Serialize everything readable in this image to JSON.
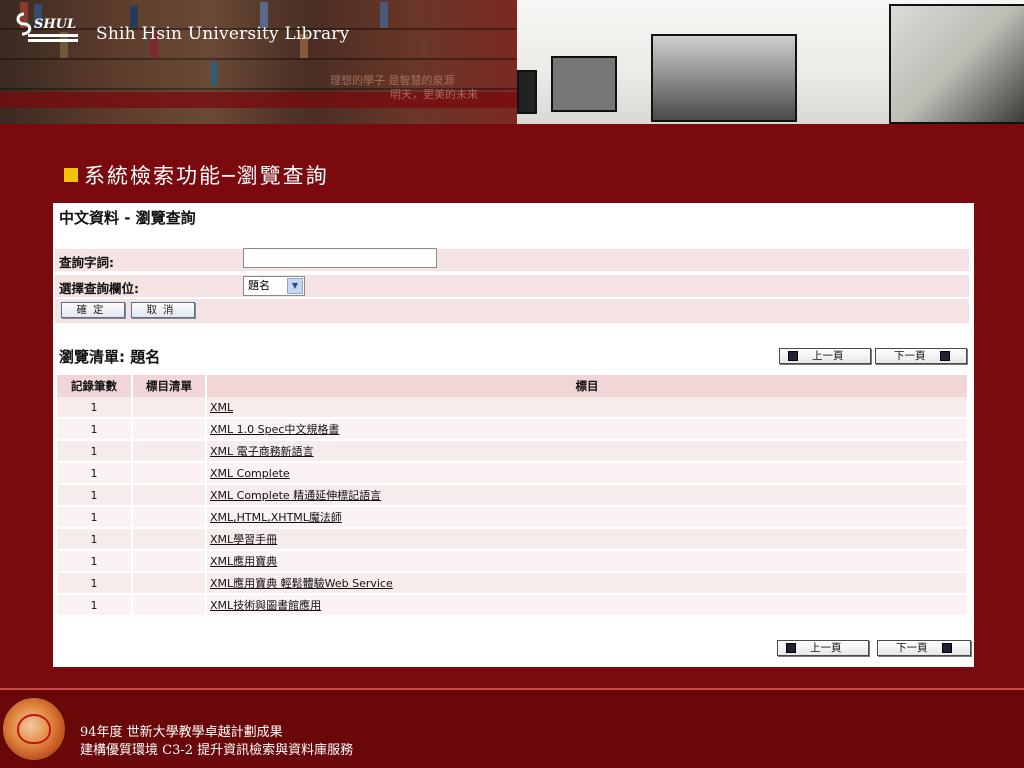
{
  "banner": {
    "library_name": "Shih Hsin University Library",
    "logo_text": "SHUL",
    "motto_line1": "理想的學子 是智慧的泉源",
    "motto_line2": "明天，更美的未來"
  },
  "slide": {
    "title": "系統檢索功能─瀏覽查詢",
    "bullet_color": "#f5c400"
  },
  "panel": {
    "title": "中文資料 - 瀏覽查詢",
    "query_label": "查詢字詞:",
    "query_value": "",
    "field_label": "選擇查詢欄位:",
    "field_selected": "題名",
    "confirm_label": "確定",
    "cancel_label": "取消",
    "list_title": "瀏覽清單: 題名",
    "prev_label": "上一頁",
    "next_label": "下一頁",
    "columns": {
      "count": "記錄筆數",
      "list": "標目清單",
      "heading": "標目"
    },
    "rows": [
      {
        "count": "1",
        "heading": "XML"
      },
      {
        "count": "1",
        "heading": "XML 1.0 Spec中文規格書"
      },
      {
        "count": "1",
        "heading": "XML 電子商務新語言"
      },
      {
        "count": "1",
        "heading": "XML Complete"
      },
      {
        "count": "1",
        "heading": "XML Complete 精通延伸標記語言"
      },
      {
        "count": "1",
        "heading": "XML,HTML,XHTML魔法師"
      },
      {
        "count": "1",
        "heading": "XML學習手冊"
      },
      {
        "count": "1",
        "heading": "XML應用寶典"
      },
      {
        "count": "1",
        "heading": "XML應用寶典 輕鬆體驗Web Service"
      },
      {
        "count": "1",
        "heading": "XML技術與圖書館應用"
      }
    ]
  },
  "footer": {
    "line1": "94年度 世新大學教學卓越計劃成果",
    "line2": "建構優質環境 C3-2 提升資訊檢索與資料庫服務"
  },
  "colors": {
    "background": "#7a0a0e",
    "footer": "#6a0709",
    "row_tint": "#f7ecec"
  }
}
